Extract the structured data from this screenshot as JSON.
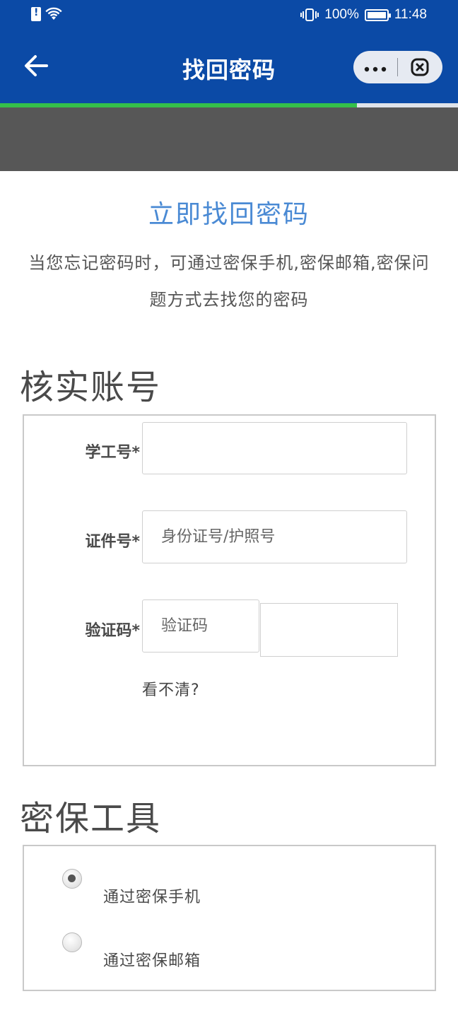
{
  "status_bar": {
    "battery_percent": "100%",
    "time": "11:48"
  },
  "header": {
    "title": "找回密码",
    "more_icon": "more-dots-icon",
    "close_icon": "close-circle-icon",
    "back_icon": "arrow-left-icon"
  },
  "page_load": {
    "progress": 0.78
  },
  "intro": {
    "title": "立即找回密码",
    "description": "当您忘记密码时，可通过密保手机,密保邮箱,密保问题方式去找您的密码"
  },
  "verify_account": {
    "section_title": "核实账号",
    "student_id": {
      "label": "学工号*",
      "value": ""
    },
    "id_number": {
      "label": "证件号*",
      "placeholder": "身份证号/护照号"
    },
    "captcha": {
      "label": "验证码*",
      "placeholder": "验证码",
      "refresh_text": "看不清?"
    }
  },
  "security_tools": {
    "section_title": "密保工具",
    "options": [
      {
        "label": "通过密保手机",
        "checked": true
      },
      {
        "label": "通过密保邮箱",
        "checked": false
      }
    ]
  },
  "colors": {
    "header_bg": "#0b4aa6",
    "accent": "#4a8ad4",
    "progress": "#35c04a"
  }
}
